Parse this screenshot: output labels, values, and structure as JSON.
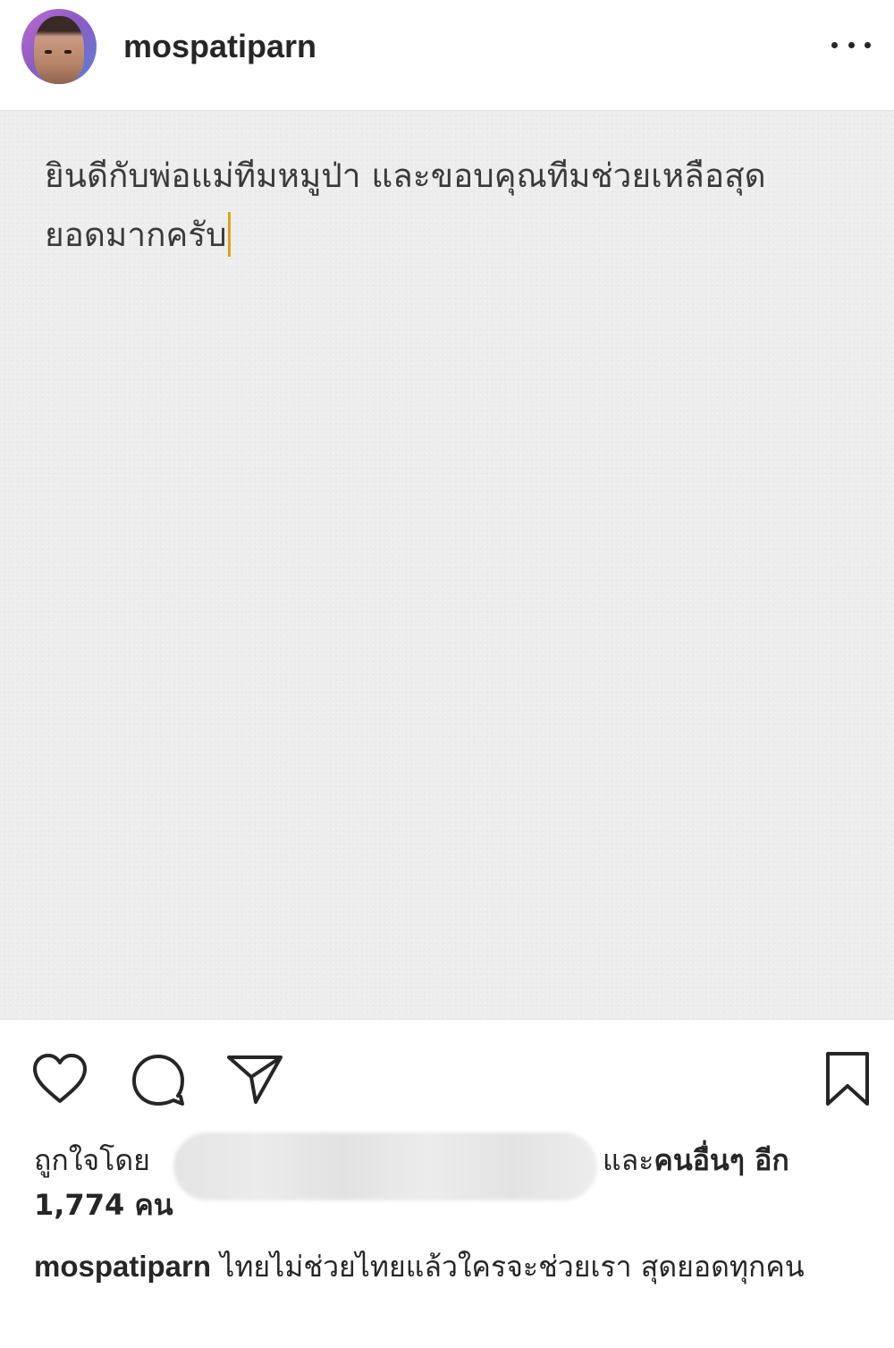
{
  "header": {
    "username": "mospatiparn",
    "more_icon": "more-horizontal-icon"
  },
  "post_image": {
    "text_line1": "ยินดีกับพ่อแม่ทีมหมูป่า และขอบคุณทีมช่วยเหลือสุด",
    "text_line2": "ยอดมากครับ",
    "caret_color": "#e0a21b"
  },
  "actions": {
    "like_icon": "heart-icon",
    "comment_icon": "comment-icon",
    "share_icon": "send-icon",
    "save_icon": "bookmark-icon"
  },
  "likes": {
    "prefix": "ถูกใจโดย",
    "suffix_and": "และ",
    "suffix_others": "คนอื่นๆ",
    "suffix_more": " อีก",
    "count": "1,774 คน"
  },
  "caption": {
    "username": "mospatiparn",
    "text": "ไทยไม่ช่วยไทยแล้วใครจะช่วยเรา สุดยอดทุกคน"
  }
}
